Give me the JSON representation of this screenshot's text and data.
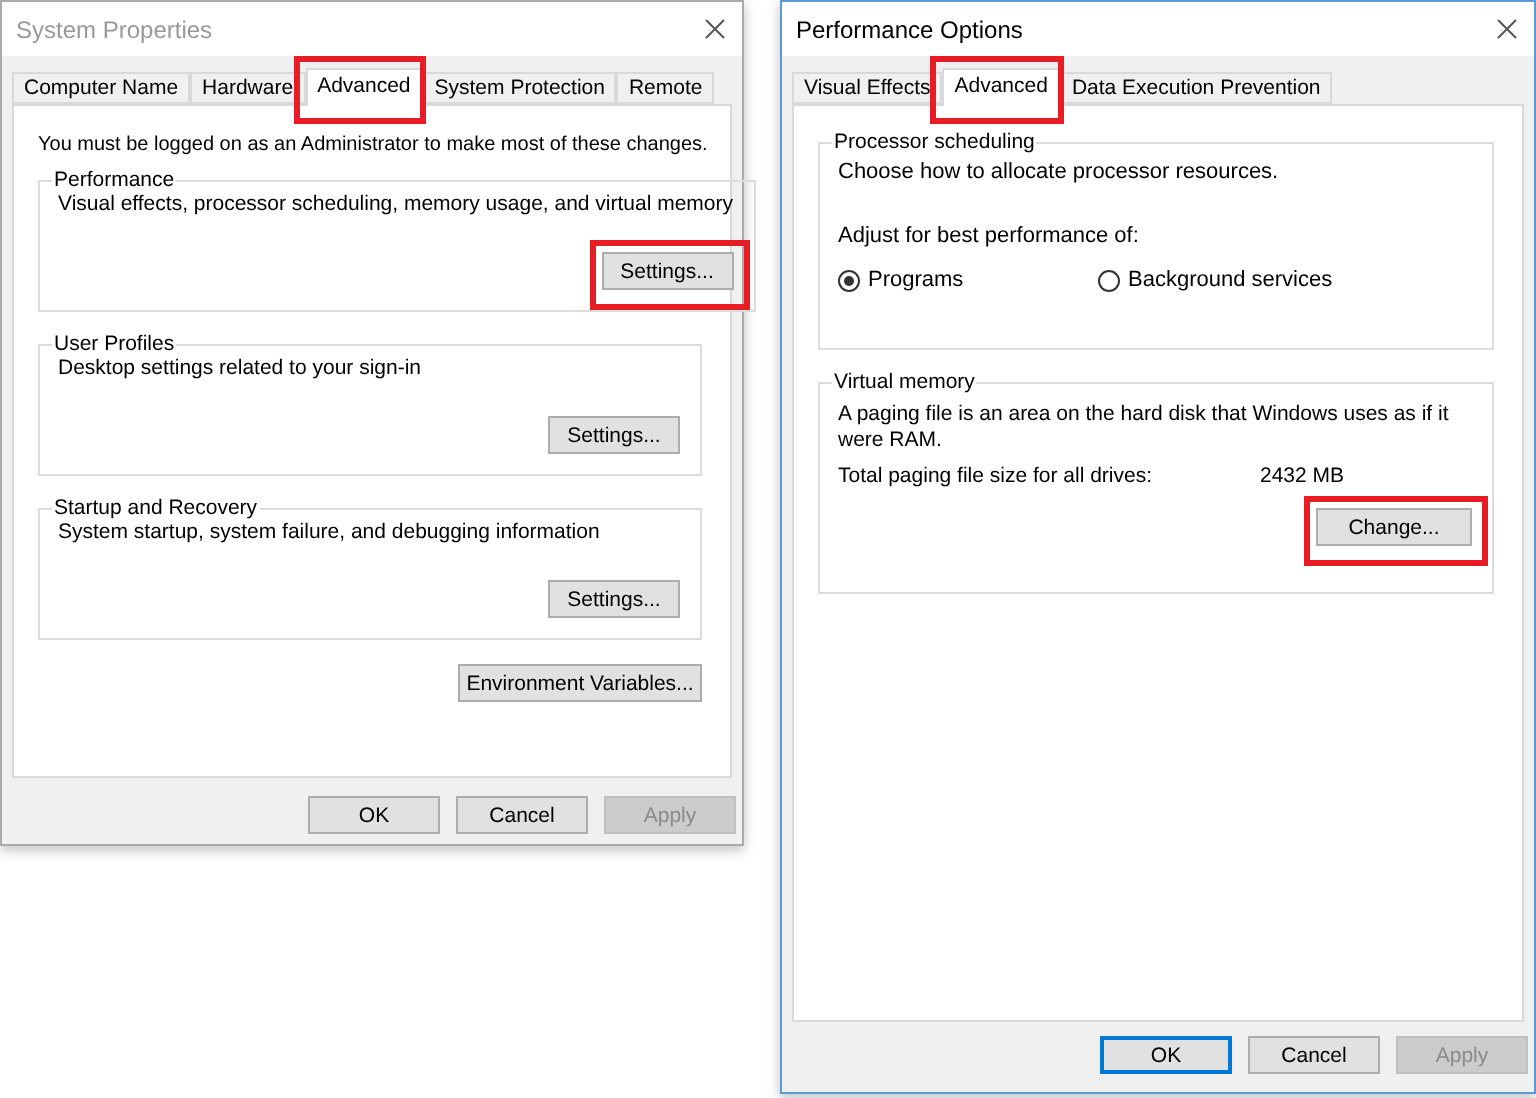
{
  "system_properties": {
    "title": "System Properties",
    "active": false,
    "tabs": [
      {
        "label": "Computer Name",
        "selected": false,
        "highlighted": false
      },
      {
        "label": "Hardware",
        "selected": false,
        "highlighted": false
      },
      {
        "label": "Advanced",
        "selected": true,
        "highlighted": true
      },
      {
        "label": "System Protection",
        "selected": false,
        "highlighted": false
      },
      {
        "label": "Remote",
        "selected": false,
        "highlighted": false
      }
    ],
    "note": "You must be logged on as an Administrator to make most of these changes.",
    "groups": [
      {
        "legend": "Performance",
        "description": "Visual effects, processor scheduling, memory usage, and virtual memory",
        "button": {
          "label": "Settings...",
          "highlighted": true
        }
      },
      {
        "legend": "User Profiles",
        "description": "Desktop settings related to your sign-in",
        "button": {
          "label": "Settings...",
          "highlighted": false
        }
      },
      {
        "legend": "Startup and Recovery",
        "description": "System startup, system failure, and debugging information",
        "button": {
          "label": "Settings...",
          "highlighted": false
        }
      }
    ],
    "extra_button": {
      "label": "Environment Variables...",
      "highlighted": false
    },
    "footer": [
      {
        "label": "OK",
        "default": false,
        "disabled": false
      },
      {
        "label": "Cancel",
        "default": false,
        "disabled": false
      },
      {
        "label": "Apply",
        "default": false,
        "disabled": true
      }
    ]
  },
  "performance_options": {
    "title": "Performance Options",
    "active": true,
    "tabs": [
      {
        "label": "Visual Effects",
        "selected": false,
        "highlighted": false
      },
      {
        "label": "Advanced",
        "selected": true,
        "highlighted": true
      },
      {
        "label": "Data Execution Prevention",
        "selected": false,
        "highlighted": false
      }
    ],
    "processor_scheduling": {
      "legend": "Processor scheduling",
      "description": "Choose how to allocate processor resources.",
      "prompt": "Adjust for best performance of:",
      "options": [
        {
          "label": "Programs",
          "selected": true
        },
        {
          "label": "Background services",
          "selected": false
        }
      ]
    },
    "virtual_memory": {
      "legend": "Virtual memory",
      "description": "A paging file is an area on the hard disk that Windows uses as if it were RAM.",
      "size_label": "Total paging file size for all drives:",
      "size_value": "2432 MB",
      "button": {
        "label": "Change...",
        "highlighted": true
      }
    },
    "footer": [
      {
        "label": "OK",
        "default": true,
        "disabled": false
      },
      {
        "label": "Cancel",
        "default": false,
        "disabled": false
      },
      {
        "label": "Apply",
        "default": false,
        "disabled": true
      }
    ]
  }
}
